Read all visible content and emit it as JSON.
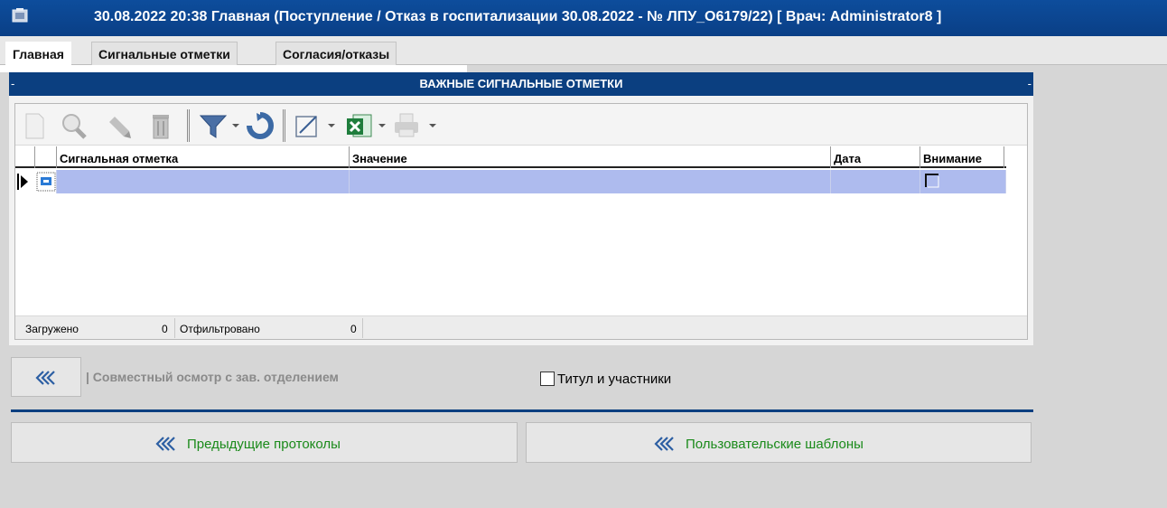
{
  "window": {
    "title": "30.08.2022 20:38  Главная (Поступление / Отказ в госпитализации 30.08.2022 - № ЛПУ_О6179/22)  [ Врач: Administrator8  ]"
  },
  "tabs": [
    {
      "label": "Главная",
      "active": true
    },
    {
      "label": "Сигнальные отметки",
      "active": false
    },
    {
      "label": "Согласия/отказы",
      "active": false
    }
  ],
  "panel": {
    "title": "ВАЖНЫЕ СИГНАЛЬНЫЕ ОТМЕТКИ",
    "dash_left": "-",
    "dash_right": "-"
  },
  "toolbar": {
    "icons": [
      "new-doc-icon",
      "search-icon",
      "edit-icon",
      "delete-icon",
      "filter-icon",
      "refresh-icon",
      "edit-grid-icon",
      "excel-icon",
      "print-icon"
    ]
  },
  "grid": {
    "columns": [
      "Сигнальная отметка",
      "Значение",
      "Дата",
      "Внимание"
    ],
    "rows": [
      {
        "signal": "",
        "value": "",
        "date": "",
        "attention": false
      }
    ]
  },
  "status": {
    "loaded_label": "Загружено",
    "loaded_value": "0",
    "filtered_label": "Отфильтровано",
    "filtered_value": "0"
  },
  "joint_exam": {
    "label": "| Совместный осмотр с зав. отделением"
  },
  "title_checkbox": {
    "label": "Титул и участники",
    "checked": false
  },
  "buttons": {
    "previous_protocols": "Предыдущие протоколы",
    "user_templates": "Пользовательские шаблоны"
  },
  "colors": {
    "titlebar": "#0b4592",
    "panel_header": "#0b3f80",
    "row_selected": "#aebbee",
    "button_text": "#1a8a1a"
  }
}
